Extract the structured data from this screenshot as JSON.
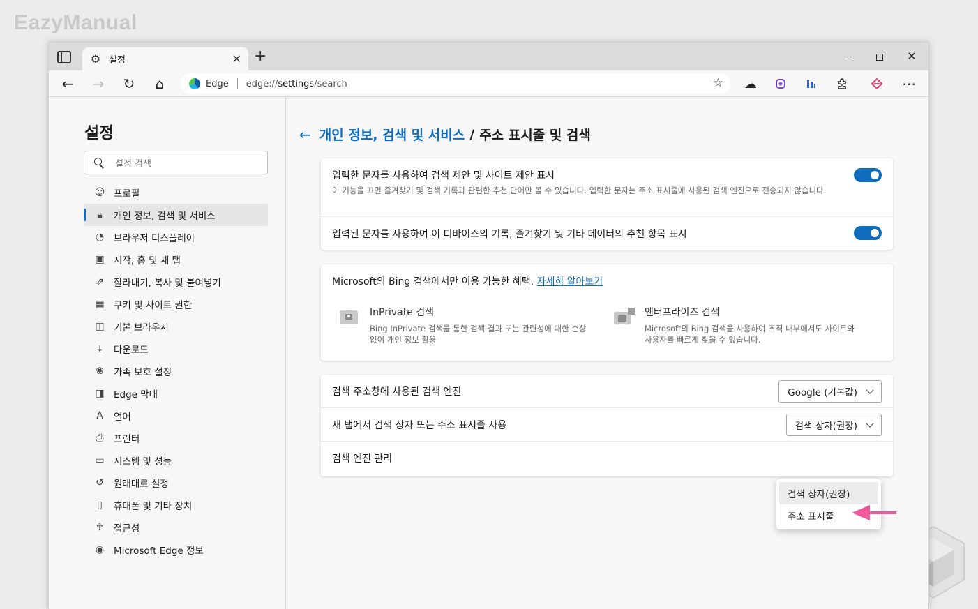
{
  "watermark": "EazyManual",
  "tab": {
    "title": "설정"
  },
  "toolbar": {
    "site_label": "Edge",
    "url_scheme": "edge://",
    "url_rest_bold": "settings",
    "url_path": "/search"
  },
  "sidebar": {
    "title": "설정",
    "search_placeholder": "설정 검색",
    "items": [
      {
        "label": "프로필",
        "icon": "profile-icon"
      },
      {
        "label": "개인 정보, 검색 및 서비스",
        "icon": "lock-icon",
        "active": true
      },
      {
        "label": "브라우저 디스플레이",
        "icon": "palette-icon"
      },
      {
        "label": "시작, 홈 및 새 탭",
        "icon": "home-tab-icon"
      },
      {
        "label": "잘라내기, 복사 및 붙여넣기",
        "icon": "share-icon"
      },
      {
        "label": "쿠키 및 사이트 권한",
        "icon": "cookie-icon"
      },
      {
        "label": "기본 브라우저",
        "icon": "browser-icon"
      },
      {
        "label": "다운로드",
        "icon": "download-icon"
      },
      {
        "label": "가족 보호 설정",
        "icon": "family-icon"
      },
      {
        "label": "Edge 막대",
        "icon": "edge-bar-icon"
      },
      {
        "label": "언어",
        "icon": "language-icon"
      },
      {
        "label": "프린터",
        "icon": "printer-icon"
      },
      {
        "label": "시스템 및 성능",
        "icon": "laptop-icon"
      },
      {
        "label": "원래대로 설정",
        "icon": "reset-icon"
      },
      {
        "label": "휴대폰 및 기타 장치",
        "icon": "phone-icon"
      },
      {
        "label": "접근성",
        "icon": "accessibility-icon"
      },
      {
        "label": "Microsoft Edge 정보",
        "icon": "edge-logo-icon"
      }
    ]
  },
  "main": {
    "crumb_parent": "개인 정보, 검색 및 서비스",
    "crumb_sep": "/",
    "crumb_current": "주소 표시줄 및 검색",
    "card1": {
      "row1_title": "입력한 문자를 사용하여 검색 제안 및 사이트 제안 표시",
      "row1_desc": "이 기능을 끄면 즐겨찾기 및 검색 기록과 관련한 추천 단어만 볼 수 있습니다. 입력한 문자는 주소 표시줄에 사용된 검색 엔진으로 전송되지 않습니다.",
      "row2_title": "입력된 문자를 사용하여 이 디바이스의 기록, 즐겨찾기 및 기타 데이터의 추천 항목 표시"
    },
    "card2": {
      "head": "Microsoft의 Bing 검색에서만 이용 가능한 혜택.",
      "link": "자세히 알아보기",
      "feat1_title": "InPrivate 검색",
      "feat1_desc": "Bing InPrivate 검색을 통한 검색 결과 또는 관련성에 대한 손상 없이 개인 정보 활용",
      "feat2_title": "엔터프라이즈 검색",
      "feat2_desc": "Microsoft의 Bing 검색을 사용하여 조직 내부에서도 사이트와 사용자를 빠르게 찾을 수 있습니다."
    },
    "card3": {
      "row1_label": "검색 주소창에 사용된 검색 엔진",
      "row1_value": "Google (기본값)",
      "row2_label": "새 탭에서 검색 상자 또는 주소 표시줄 사용",
      "row2_value": "검색 상자(권장)",
      "row3_label": "검색 엔진 관리"
    },
    "dropdown_options": [
      "검색 상자(권장)",
      "주소 표시줄"
    ]
  },
  "colors": {
    "accent": "#0f6cbd",
    "arrow": "#f05a9d"
  }
}
